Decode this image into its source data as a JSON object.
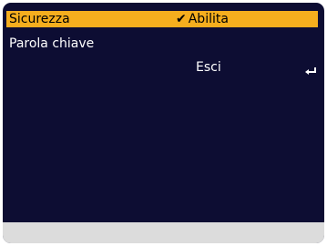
{
  "menu": {
    "security": {
      "label": "Sicurezza",
      "value": "Abilita",
      "check_icon": "check-icon",
      "selected": true
    },
    "keyword": {
      "label": "Parola chiave"
    },
    "exit": {
      "label": "Esci",
      "enter_icon": "enter-return-icon"
    }
  },
  "colors": {
    "background": "#0d0d33",
    "highlight": "#f5ae1e",
    "text": "#ffffff",
    "highlight_text": "#000000",
    "bottom_bar": "#dcdcdc"
  }
}
